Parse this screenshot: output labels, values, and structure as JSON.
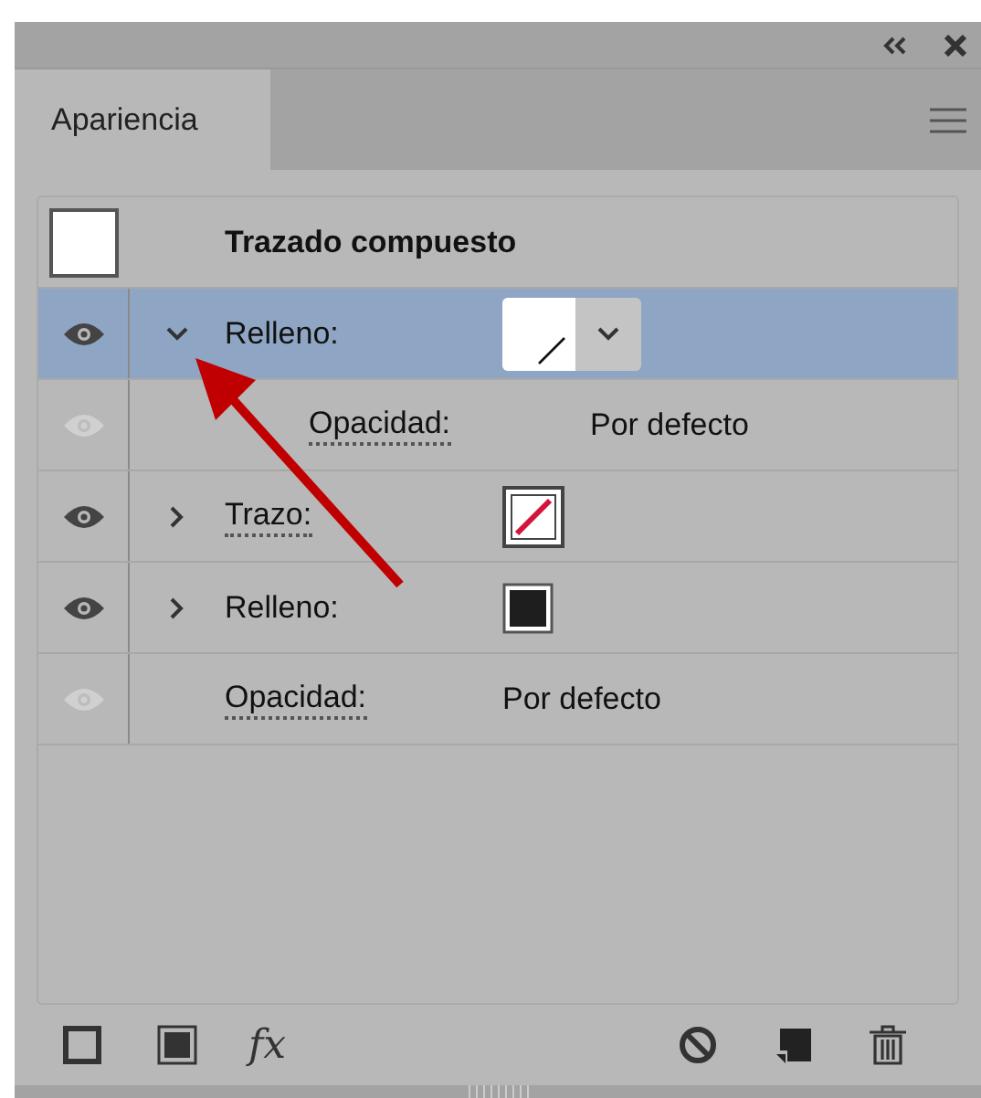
{
  "panel": {
    "tab": {
      "label": "Apariencia",
      "selected": true
    }
  },
  "object": {
    "title": "Trazado compuesto"
  },
  "rows": [
    {
      "kind": "fill",
      "label": "Relleno:",
      "link": false,
      "eye_enabled": true,
      "expanded": true,
      "selected": true,
      "swatch": {
        "kind": "none_dropdown"
      },
      "children": [
        {
          "kind": "opacity",
          "label": "Opacidad:",
          "link": true,
          "eye_enabled": false,
          "selected": false,
          "value": "Por defecto"
        }
      ]
    },
    {
      "kind": "stroke",
      "label": "Trazo:",
      "link": true,
      "eye_enabled": true,
      "expanded": false,
      "selected": false,
      "swatch": {
        "kind": "red_slash"
      }
    },
    {
      "kind": "fill",
      "label": "Relleno:",
      "link": false,
      "eye_enabled": true,
      "expanded": false,
      "selected": false,
      "swatch": {
        "kind": "black"
      }
    },
    {
      "kind": "opacity",
      "label": "Opacidad:",
      "link": true,
      "eye_enabled": false,
      "selected": false,
      "value": "Por defecto"
    }
  ],
  "footer": {
    "effects_label": "fx"
  }
}
